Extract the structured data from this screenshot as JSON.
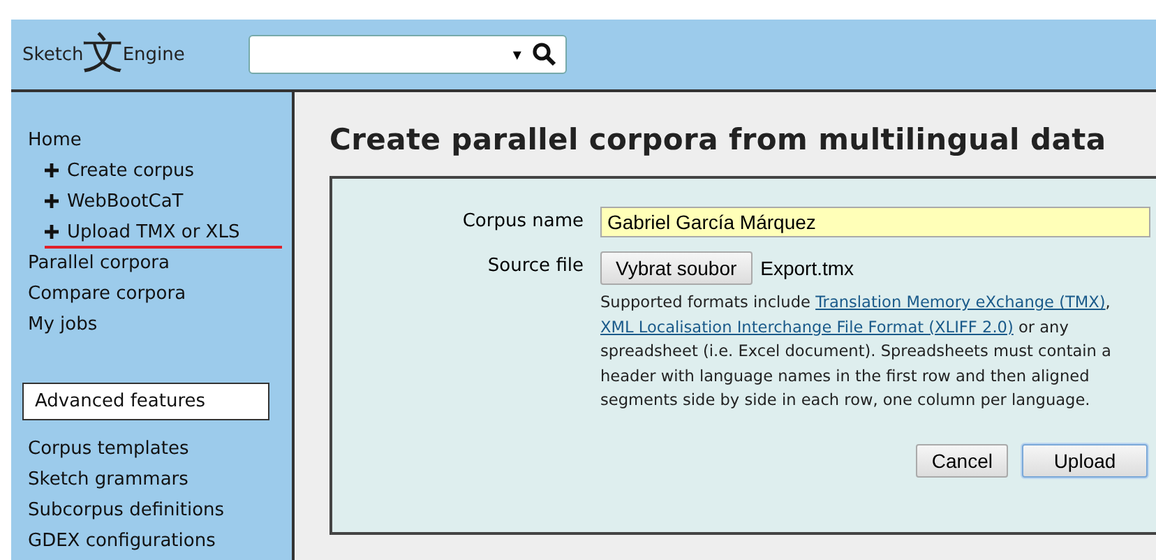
{
  "logo": {
    "left": "Sketch",
    "glyph": "文",
    "right": "Engine"
  },
  "search": {
    "dropdown": "▾"
  },
  "sidebar": {
    "items": [
      {
        "label": "Home",
        "underlined": false,
        "children": [
          {
            "label": "Create corpus",
            "underlined": false
          },
          {
            "label": "WebBootCaT",
            "underlined": false
          },
          {
            "label": "Upload TMX or XLS",
            "underlined": true
          }
        ]
      },
      {
        "label": "Parallel corpora",
        "underlined": false
      },
      {
        "label": "Compare corpora",
        "underlined": false
      },
      {
        "label": "My jobs",
        "underlined": false
      }
    ],
    "section": "Advanced features",
    "advanced": [
      "Corpus templates",
      "Sketch grammars",
      "Subcorpus definitions",
      "GDEX configurations"
    ]
  },
  "page_title": "Create parallel corpora from multilingual data",
  "form": {
    "corpus_name": {
      "label": "Corpus name",
      "value": "Gabriel García Márquez"
    },
    "source_file": {
      "label": "Source file",
      "button": "Vybrat soubor",
      "file": "Export.tmx"
    },
    "help": [
      {
        "text": "Supported formats include ",
        "link": false
      },
      {
        "text": "Translation Memory eXchange (TMX)",
        "link": true
      },
      {
        "text": ", ",
        "link": false
      },
      {
        "text": "XML Localisation Interchange File Format (XLIFF 2.0)",
        "link": true
      },
      {
        "text": " or any spreadsheet (i.e. Excel document). Spreadsheets must contain a header with language names in the first row and then aligned segments side by side in each row, one column per language.",
        "link": false
      }
    ],
    "buttons": [
      {
        "label": "Cancel",
        "primary": false
      },
      {
        "label": "Upload",
        "primary": true
      }
    ]
  }
}
